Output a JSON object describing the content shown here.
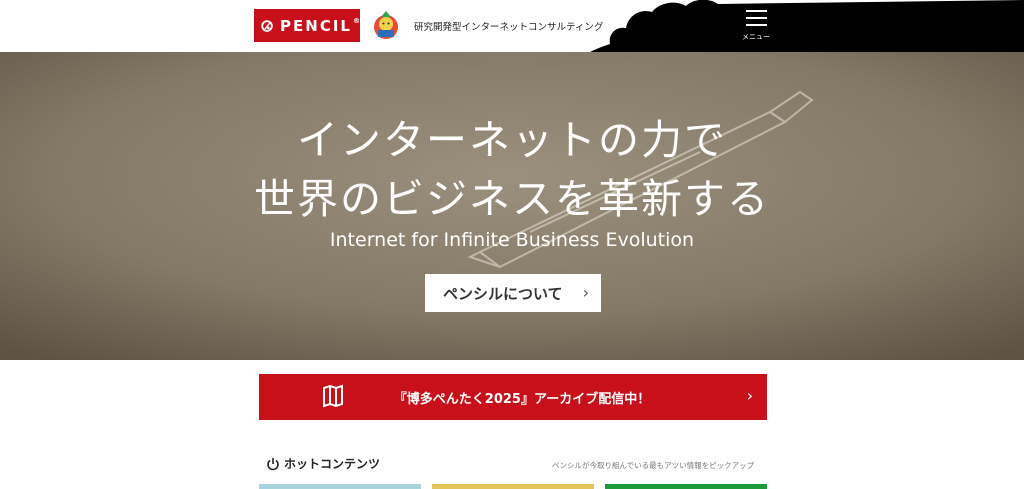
{
  "header": {
    "logo_text": "PENCIL",
    "tagline": "研究開発型インターネットコンサルティング",
    "menu_label": "メニュー"
  },
  "hero": {
    "line1": "インターネットの力で",
    "line2": "世界のビジネスを革新する",
    "subtitle": "Internet for Infinite Business Evolution",
    "button_label": "ペンシルについて",
    "button_chevron": "›"
  },
  "banner": {
    "text": "『博多ぺんたく2025』アーカイブ配信中！",
    "chevron": "›"
  },
  "hot_contents": {
    "title": "ホットコンテンツ",
    "subtitle": "ペンシルが今取り組んでいる最もアツい情報をピックアップ",
    "strip_colors": [
      "#a7d4dd",
      "#e2c25a",
      "#1f9b3c"
    ]
  },
  "colors": {
    "brand_red": "#c8101a",
    "header_black": "#000000",
    "hero_bg": "#7f7463"
  },
  "icons": {
    "menu": "hamburger-icon",
    "banner": "map-icon",
    "hot": "power-icon"
  }
}
